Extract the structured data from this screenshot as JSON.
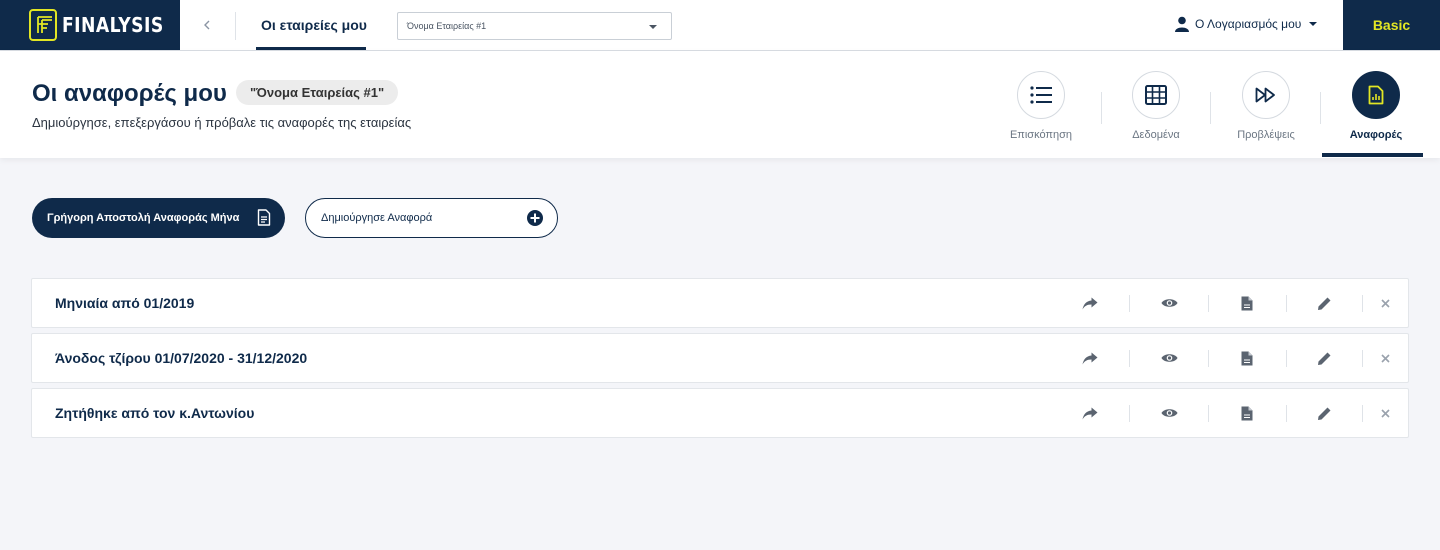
{
  "app": {
    "logo_text": "FINALYSIS",
    "plan": "Basic"
  },
  "topnav": {
    "title": "Οι εταιρείες μου",
    "company_select_value": "Όνομα Εταιρείας #1",
    "account_label": "Ο Λογαριασμός μου"
  },
  "header": {
    "title": "Οι αναφορές μου",
    "company_badge": "\"Όνομα Εταιρείας #1\"",
    "subtitle": "Δημιούργησε, επεξεργάσου ή πρόβαλε τις αναφορές της εταιρείας",
    "tabs": [
      {
        "label": "Επισκόπηση",
        "icon": "list-icon",
        "active": false
      },
      {
        "label": "Δεδομένα",
        "icon": "table-icon",
        "active": false
      },
      {
        "label": "Προβλέψεις",
        "icon": "fast-forward-icon",
        "active": false
      },
      {
        "label": "Αναφορές",
        "icon": "report-icon",
        "active": true
      }
    ]
  },
  "actions": {
    "quick_send_label": "Γρήγορη Αποστολή Αναφοράς Μήνα",
    "create_label": "Δημιούργησε Αναφορά"
  },
  "reports": [
    {
      "title": "Μηνιαία από 01/2019"
    },
    {
      "title": "Άνοδος τζίρου 01/07/2020 - 31/12/2020"
    },
    {
      "title": "Ζητήθηκε από τον κ.Αντωνίου"
    }
  ],
  "colors": {
    "navy": "#0f2a4a",
    "accent_yellow": "#e2e624",
    "background": "#f4f5f9"
  }
}
